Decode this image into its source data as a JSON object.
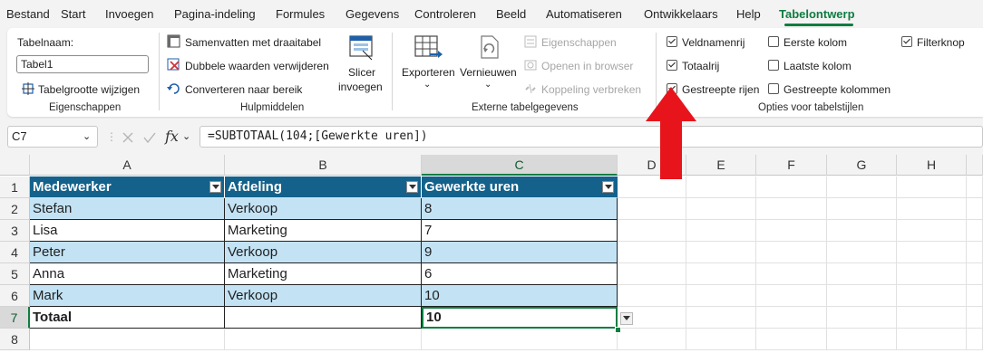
{
  "menu": {
    "tabs": [
      "Bestand",
      "Start",
      "Invoegen",
      "Pagina-indeling",
      "Formules",
      "Gegevens",
      "Controleren",
      "Beeld",
      "Automatiseren",
      "Ontwikkelaars",
      "Help",
      "Tabelontwerp"
    ],
    "active": "Tabelontwerp"
  },
  "ribbon": {
    "eigenschappen": {
      "table_name_label": "Tabelnaam:",
      "table_name_value": "Tabel1",
      "resize_label": "Tabelgrootte wijzigen",
      "group_label": "Eigenschappen"
    },
    "hulpmiddelen": {
      "pivot_label": "Samenvatten met draaitabel",
      "remove_dupes_label": "Dubbele waarden verwijderen",
      "convert_label": "Converteren naar bereik",
      "slicer_label_line1": "Slicer",
      "slicer_label_line2": "invoegen",
      "group_label": "Hulpmiddelen"
    },
    "extern": {
      "export_label": "Exporteren",
      "refresh_label": "Vernieuwen",
      "properties_label": "Eigenschappen",
      "open_browser_label": "Openen in browser",
      "unlink_label": "Koppeling verbreken",
      "group_label": "Externe tabelgegevens"
    },
    "opties": {
      "header_row": {
        "label": "Veldnamenrij",
        "checked": true
      },
      "total_row": {
        "label": "Totaalrij",
        "checked": true
      },
      "banded_rows": {
        "label": "Gestreepte rijen",
        "checked": true
      },
      "first_column": {
        "label": "Eerste kolom",
        "checked": false
      },
      "last_column": {
        "label": "Laatste kolom",
        "checked": false
      },
      "banded_columns": {
        "label": "Gestreepte kolommen",
        "checked": false
      },
      "filter_button": {
        "label": "Filterknop",
        "checked": true
      },
      "group_label": "Opties voor tabelstijlen"
    }
  },
  "formula_bar": {
    "name_box": "C7",
    "fx_label": "fx",
    "formula": "=SUBTOTAAL(104;[Gewerkte uren])"
  },
  "sheet": {
    "columns": [
      "A",
      "B",
      "C",
      "D",
      "E",
      "F",
      "G",
      "H"
    ],
    "rows": [
      "1",
      "2",
      "3",
      "4",
      "5",
      "6",
      "7",
      "8"
    ],
    "table": {
      "headers": [
        "Medewerker",
        "Afdeling",
        "Gewerkte uren"
      ],
      "data": [
        [
          "Stefan",
          "Verkoop",
          "8"
        ],
        [
          "Lisa",
          "Marketing",
          "7"
        ],
        [
          "Peter",
          "Verkoop",
          "9"
        ],
        [
          "Anna",
          "Marketing",
          "6"
        ],
        [
          "Mark",
          "Verkoop",
          "10"
        ]
      ],
      "total": [
        "Totaal",
        "",
        "10"
      ]
    },
    "selected_cell": "C7"
  },
  "colors": {
    "accent": "#107c41",
    "table_header": "#14628b",
    "table_band": "#c3e3f5",
    "arrow": "#e8141c"
  }
}
